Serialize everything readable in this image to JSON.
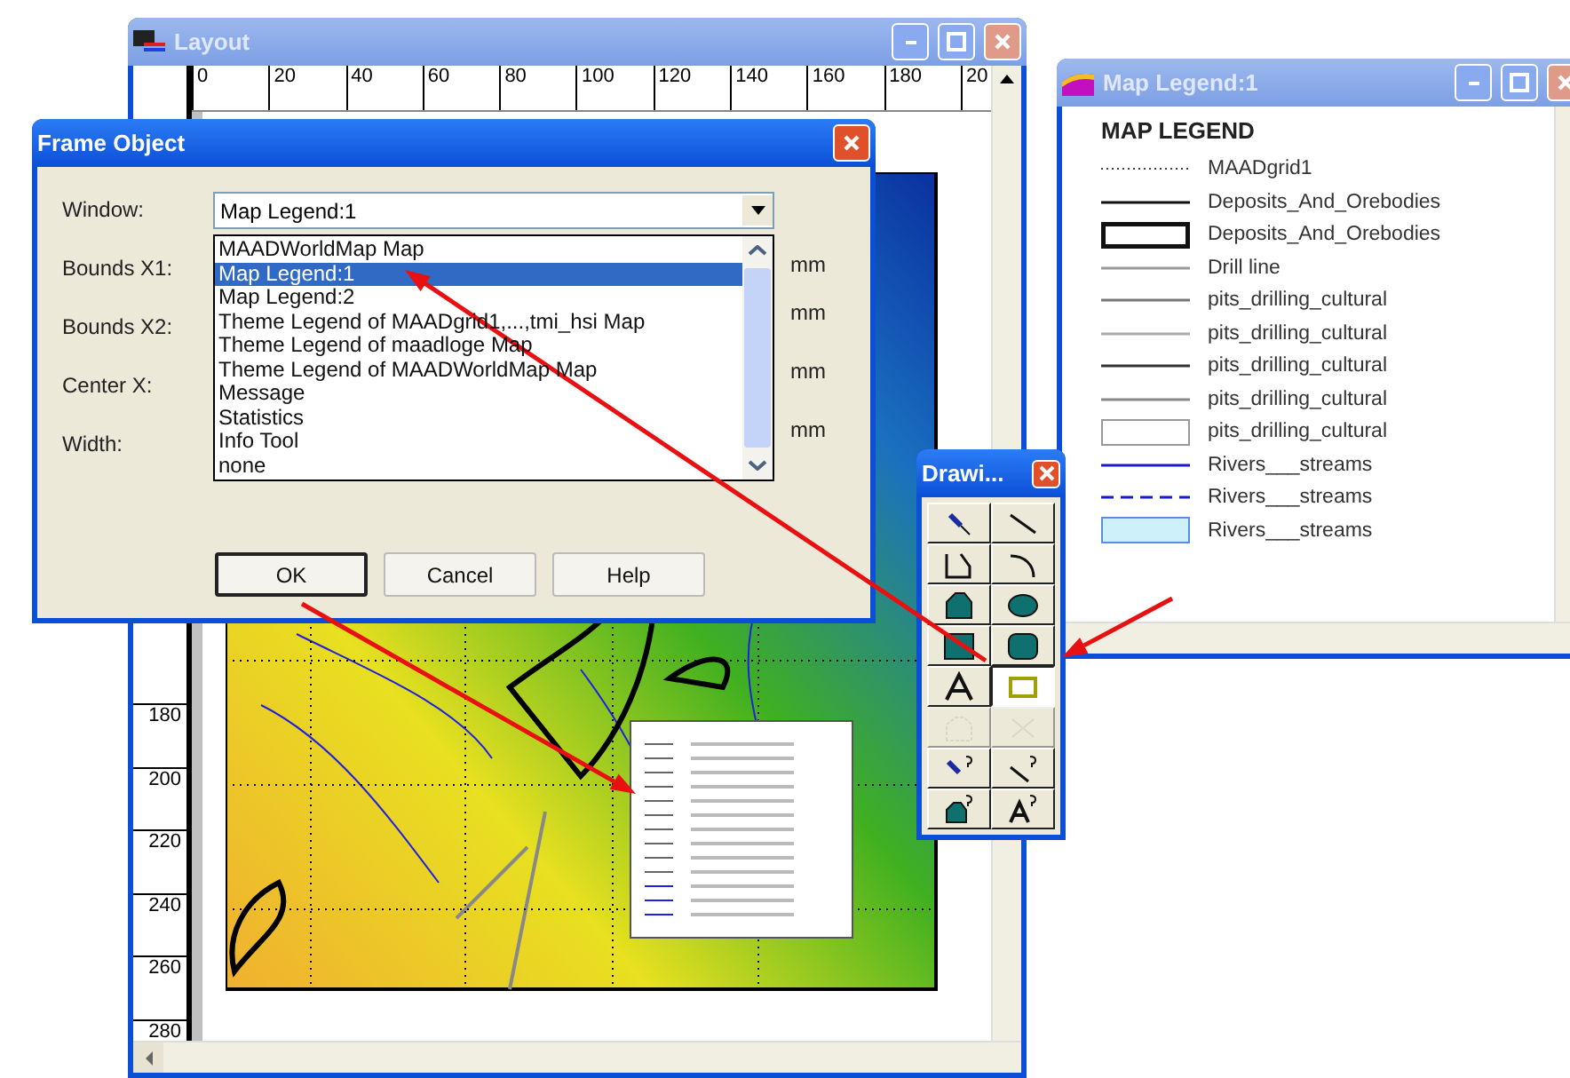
{
  "layout_window": {
    "title": "Layout",
    "top_ruler": [
      "0",
      "20",
      "40",
      "60",
      "80",
      "100",
      "120",
      "140",
      "160",
      "180",
      "20"
    ],
    "left_ruler": [
      "180",
      "200",
      "220",
      "240",
      "260",
      "280"
    ]
  },
  "frame_dialog": {
    "title": "Frame Object",
    "fields": [
      {
        "label": "Window:",
        "value": "Map Legend:1"
      },
      {
        "label": "Bounds X1:",
        "unit": "mm"
      },
      {
        "label": "Bounds X2:",
        "unit": "mm"
      },
      {
        "label": "Center X:",
        "unit": "mm"
      },
      {
        "label": "Width:",
        "unit": "mm"
      }
    ],
    "list": [
      {
        "label": "MAADWorldMap Map",
        "selected": false
      },
      {
        "label": "Map Legend:1",
        "selected": true
      },
      {
        "label": "Map Legend:2",
        "selected": false
      },
      {
        "label": "Theme Legend of MAADgrid1,...,tmi_hsi Map",
        "selected": false
      },
      {
        "label": "Theme Legend of maadloge Map",
        "selected": false
      },
      {
        "label": "Theme Legend of MAADWorldMap Map",
        "selected": false
      },
      {
        "label": "Message",
        "selected": false
      },
      {
        "label": "Statistics",
        "selected": false
      },
      {
        "label": "Info Tool",
        "selected": false
      },
      {
        "label": "none",
        "selected": false
      }
    ],
    "buttons": [
      {
        "label": "OK",
        "default": true
      },
      {
        "label": "Cancel",
        "default": false
      },
      {
        "label": "Help",
        "default": false
      }
    ]
  },
  "legend_window": {
    "title": "Map Legend:1",
    "heading": "MAP LEGEND",
    "items": [
      {
        "kind": "dotted",
        "color": "#444444",
        "label": "MAADgrid1"
      },
      {
        "kind": "line",
        "color": "#111111",
        "label": "Deposits_And_Orebodies"
      },
      {
        "kind": "thick-box",
        "color": "#111111",
        "label": "Deposits_And_Orebodies"
      },
      {
        "kind": "line",
        "color": "#999999",
        "label": "Drill line"
      },
      {
        "kind": "line",
        "color": "#777777",
        "label": "pits_drilling_cultural"
      },
      {
        "kind": "line",
        "color": "#aaaaaa",
        "label": "pits_drilling_cultural"
      },
      {
        "kind": "line",
        "color": "#333333",
        "label": "pits_drilling_cultural"
      },
      {
        "kind": "line",
        "color": "#888888",
        "label": "pits_drilling_cultural"
      },
      {
        "kind": "box",
        "color": "#999999",
        "label": "pits_drilling_cultural"
      },
      {
        "kind": "line",
        "color": "#1a1acc",
        "label": "Rivers___streams"
      },
      {
        "kind": "dashed",
        "color": "#1a1acc",
        "label": "Rivers___streams"
      },
      {
        "kind": "filled-box",
        "color": "#5a8ee6",
        "label": "Rivers___streams"
      }
    ]
  },
  "drawing_toolbar": {
    "title": "Drawi...",
    "tools": [
      {
        "kind": "symbol",
        "selected": false,
        "disabled": false
      },
      {
        "kind": "line",
        "selected": false,
        "disabled": false
      },
      {
        "kind": "polyline",
        "selected": false,
        "disabled": false
      },
      {
        "kind": "arc",
        "selected": false,
        "disabled": false
      },
      {
        "kind": "polygon",
        "selected": false,
        "disabled": false
      },
      {
        "kind": "ellipse",
        "selected": false,
        "disabled": false
      },
      {
        "kind": "rectangle",
        "selected": false,
        "disabled": false
      },
      {
        "kind": "rounded-rectangle",
        "selected": false,
        "disabled": false
      },
      {
        "kind": "text",
        "selected": false,
        "disabled": false
      },
      {
        "kind": "frame",
        "selected": true,
        "disabled": false
      },
      {
        "kind": "reshape",
        "selected": false,
        "disabled": true
      },
      {
        "kind": "add-node",
        "selected": false,
        "disabled": true
      },
      {
        "kind": "symbol-style",
        "selected": false,
        "disabled": false
      },
      {
        "kind": "line-style",
        "selected": false,
        "disabled": false
      },
      {
        "kind": "region-style",
        "selected": false,
        "disabled": false
      },
      {
        "kind": "text-style",
        "selected": false,
        "disabled": false
      }
    ]
  }
}
